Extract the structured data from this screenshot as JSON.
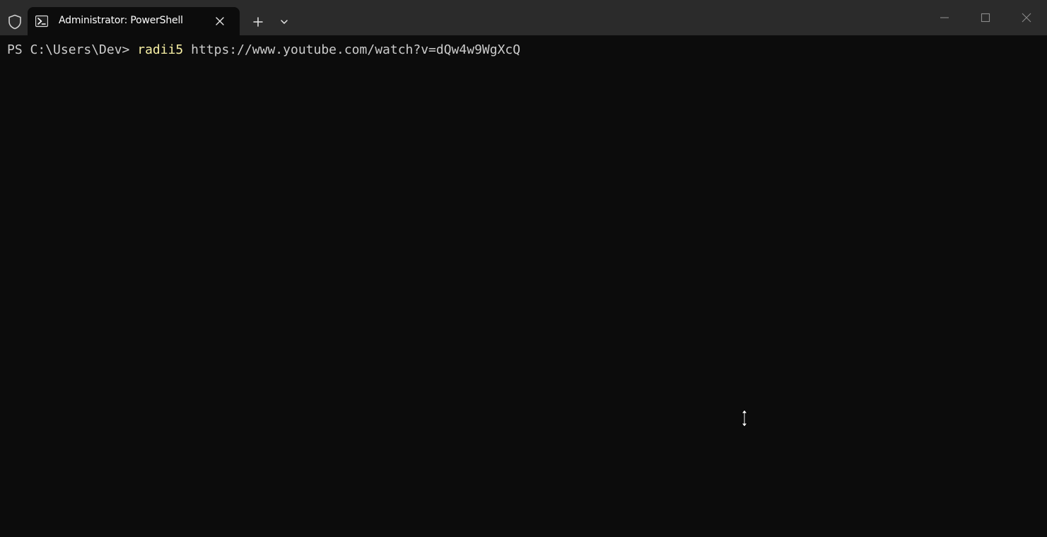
{
  "window": {
    "tab_title": "Administrator: PowerShell",
    "icons": {
      "admin": "shield-icon",
      "tab": "powershell-icon",
      "tab_close": "close-icon",
      "new_tab": "plus-icon",
      "tab_dropdown": "chevron-down-icon",
      "minimize": "minimize-icon",
      "maximize": "maximize-icon",
      "close": "close-icon",
      "pointer": "vertical-resize-cursor-icon"
    }
  },
  "terminal": {
    "prompt": "PS C:\\Users\\Dev> ",
    "command": "radii5",
    "argument": " https://www.youtube.com/watch?v=dQw4w9WgXcQ"
  },
  "colors": {
    "background": "#0c0c0c",
    "titlebar": "#2b2b2b",
    "text": "#cccccc",
    "command": "#f9f1a5"
  }
}
